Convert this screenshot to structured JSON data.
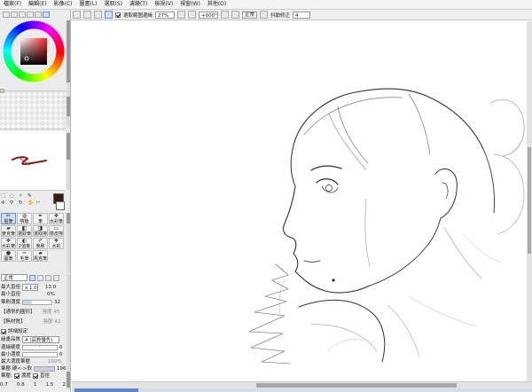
{
  "menu": [
    "檔案(F)",
    "編輯(E)",
    "影像(C)",
    "圖層(L)",
    "選取(S)",
    "濾鏡(T)",
    "檢視(V)",
    "視窗(W)",
    "其他(O)"
  ],
  "toolbar": {
    "select_source_label": "選取範圍邊緣",
    "zoom": "27%",
    "rotation": "+000°",
    "normal_button": "正常",
    "stabilizer_label": "抖動修正",
    "stabilizer_value": "4"
  },
  "colors": {
    "primary": "#3b1a12",
    "secondary": "#ffffff",
    "wheel_hue": "#ff2020",
    "stroke_preview": "#8a1a1a",
    "selection_blue": "#5f86c5"
  },
  "tools": {
    "items": [
      "鉛筆",
      "噴槍",
      "筆",
      "水彩筆",
      "麥克筆",
      "選取筆",
      "選取擦",
      "橡皮擦",
      "水彩筆",
      "2值筆",
      "筆刷",
      "水彩",
      "圓筆",
      "毛筆",
      "馬克筆"
    ],
    "selected_index": 0
  },
  "brush": {
    "mode": "正常",
    "max_size_label": "最大直徑",
    "max_size_multiplier": "x 1.0",
    "max_size_value": "13.0",
    "min_size_label": "最小直徑",
    "min_size_value": "0%",
    "density_label": "筆刷濃度",
    "density_value": "32",
    "density_fraction": 0.32,
    "shape_label": "【通常的圓形】",
    "shape_strength_label": "強度",
    "shape_strength_value": "45",
    "texture_label": "【無材質】",
    "texture_strength_label": "強度",
    "texture_strength_value": "42",
    "advanced_label": "詳細設定",
    "quality_label": "繪畫品質",
    "quality_value": "4 (品質優先)",
    "edge_hardness_label": "邊緣硬度",
    "edge_hardness_value": "0",
    "min_density_label": "最小濃度",
    "min_density_value": "0",
    "max_density_pressure_label": "最大濃度筆壓",
    "max_density_pressure_value": "100%",
    "pressure_hardness_label": "筆壓 硬<->軟",
    "pressure_hardness_value": "196",
    "pressure_label": "筆壓:",
    "pressure_density": "濃度",
    "pressure_size": "直徑",
    "presets": [
      "0.7",
      "0.8",
      "1",
      "1.5",
      "2"
    ]
  }
}
